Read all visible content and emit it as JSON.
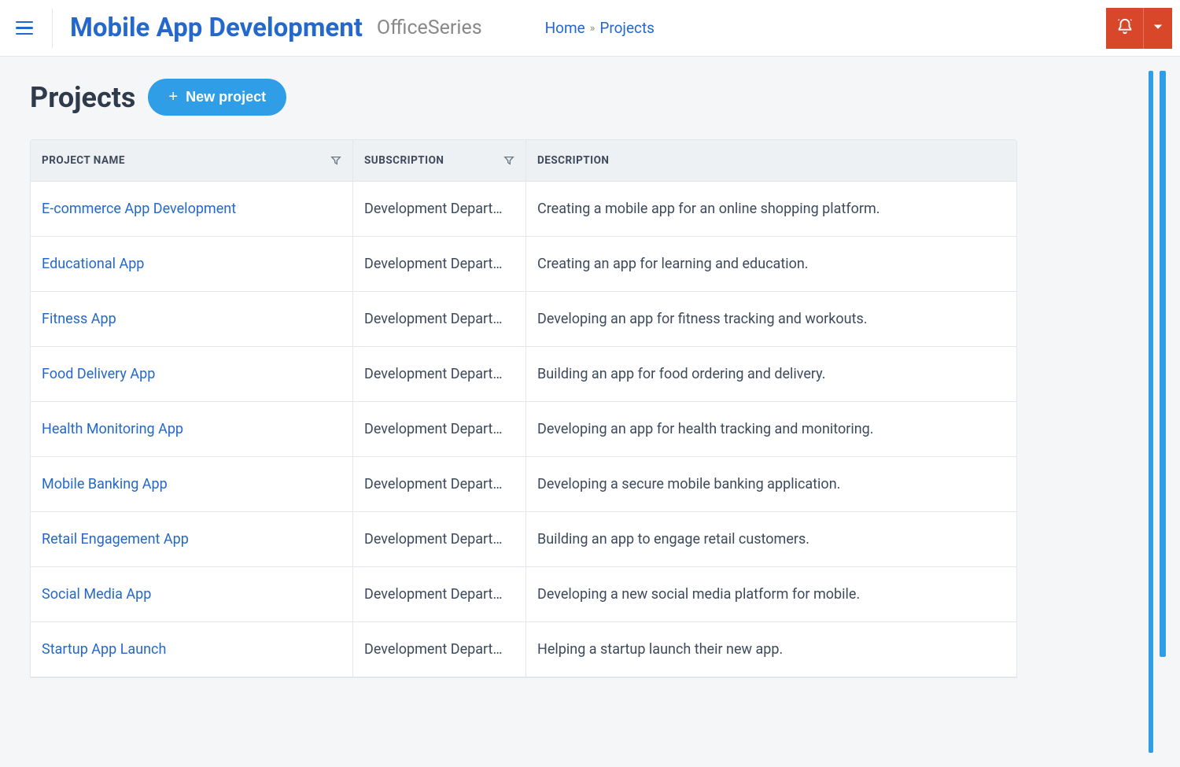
{
  "header": {
    "title": "Mobile App Development",
    "subtitle": "OfficeSeries"
  },
  "breadcrumb": {
    "home": "Home",
    "current": "Projects"
  },
  "page": {
    "title": "Projects",
    "new_button": "New project"
  },
  "table": {
    "columns": {
      "name": "PROJECT NAME",
      "subscription": "SUBSCRIPTION",
      "description": "DESCRIPTION"
    },
    "rows": [
      {
        "name": "E-commerce App Development",
        "subscription": "Development Depart…",
        "description": "Creating a mobile app for an online shopping platform."
      },
      {
        "name": "Educational App",
        "subscription": "Development Depart…",
        "description": "Creating an app for learning and education."
      },
      {
        "name": "Fitness App",
        "subscription": "Development Depart…",
        "description": "Developing an app for fitness tracking and workouts."
      },
      {
        "name": "Food Delivery App",
        "subscription": "Development Depart…",
        "description": "Building an app for food ordering and delivery."
      },
      {
        "name": "Health Monitoring App",
        "subscription": "Development Depart…",
        "description": "Developing an app for health tracking and monitoring."
      },
      {
        "name": "Mobile Banking App",
        "subscription": "Development Depart…",
        "description": "Developing a secure mobile banking application."
      },
      {
        "name": "Retail Engagement App",
        "subscription": "Development Depart…",
        "description": "Building an app to engage retail customers."
      },
      {
        "name": "Social Media App",
        "subscription": "Development Depart…",
        "description": "Developing a new social media platform for mobile."
      },
      {
        "name": "Startup App Launch",
        "subscription": "Development Depart…",
        "description": "Helping a startup launch their new app."
      }
    ]
  }
}
